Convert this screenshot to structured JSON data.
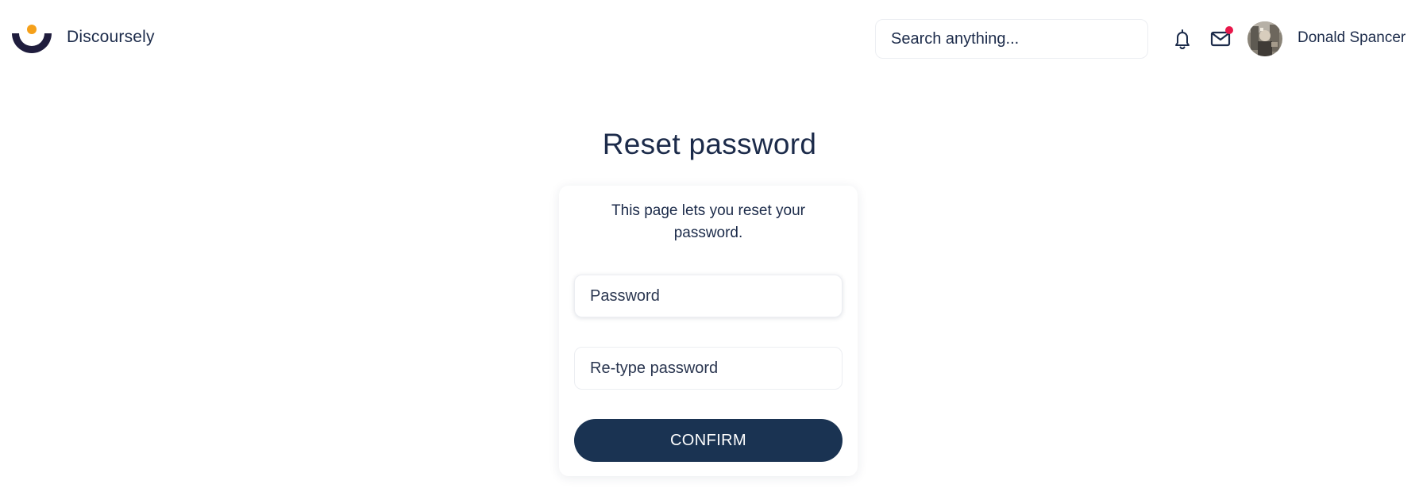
{
  "header": {
    "brand_name": "Discoursely",
    "search_placeholder": "Search anything...",
    "user_name": "Donald Spancer",
    "notification_icon": "bell-icon",
    "mail_icon": "mail-icon",
    "mail_unread_indicator": true
  },
  "main": {
    "title": "Reset password",
    "description": "This page lets you reset your password.",
    "password_placeholder": "Password",
    "retype_placeholder": "Re-type password",
    "confirm_label": "CONFIRM"
  },
  "colors": {
    "primary": "#1a3352",
    "text": "#1c2b4a",
    "logo_dark": "#1f1d3d",
    "logo_accent": "#f5a01a",
    "notification_dot": "#e8174a"
  }
}
